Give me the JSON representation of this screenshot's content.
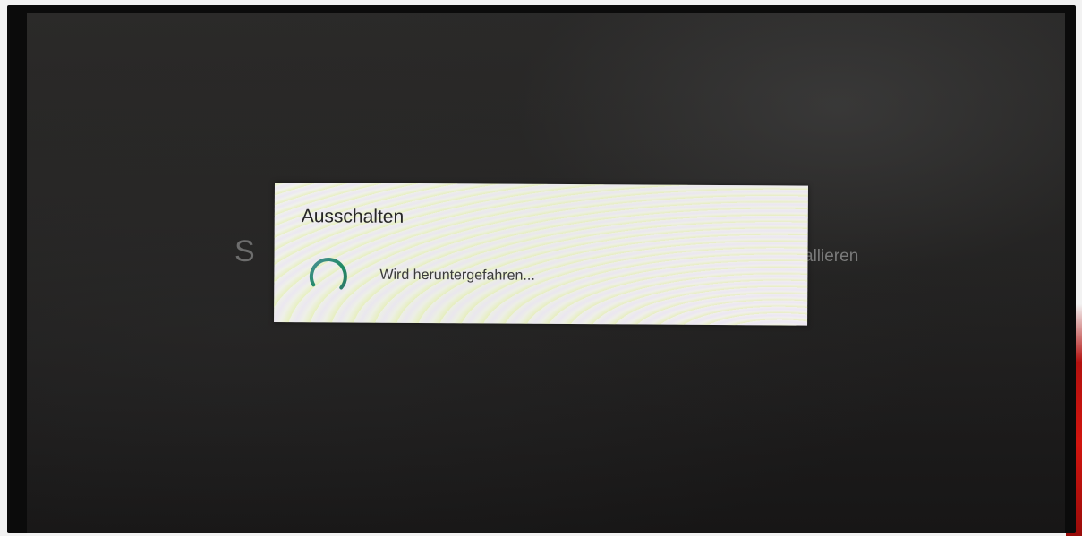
{
  "background": {
    "left_fragment": "S",
    "right_fragment": "allieren"
  },
  "dialog": {
    "title": "Ausschalten",
    "message": "Wird heruntergefahren...",
    "spinner_icon": "progress-spinner-icon",
    "accent_color": "#1e8a62"
  }
}
